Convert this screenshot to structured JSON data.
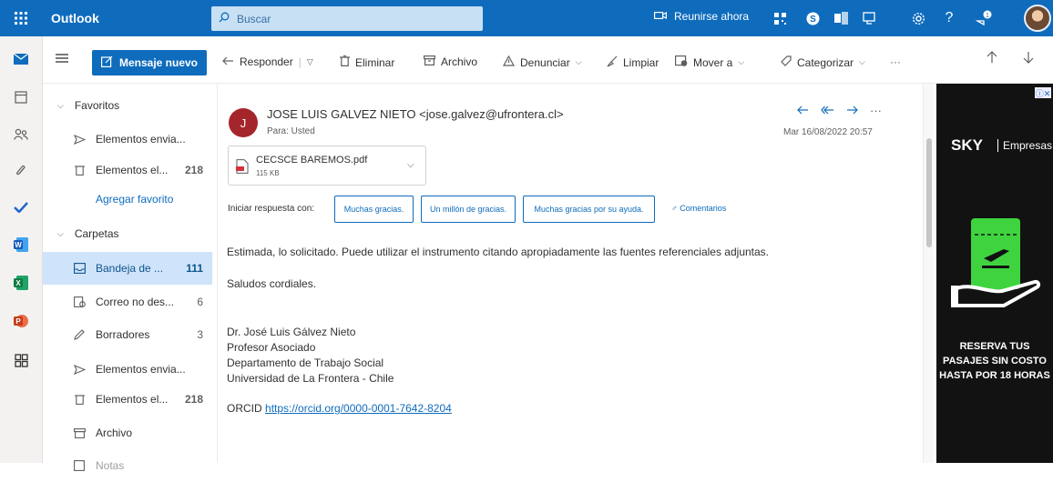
{
  "topbar": {
    "app_name": "Outlook",
    "search_placeholder": "Buscar",
    "meet_now": "Reunirse ahora",
    "notification_count": "1"
  },
  "commands": {
    "new_message": "Mensaje nuevo",
    "reply": "Responder",
    "delete": "Eliminar",
    "archive": "Archivo",
    "report": "Denunciar",
    "sweep": "Limpiar",
    "move_to": "Mover a",
    "categorize": "Categorizar",
    "more": "···"
  },
  "folders": {
    "favorites_header": "Favoritos",
    "favorites": [
      {
        "label": "Elementos envia...",
        "count": ""
      },
      {
        "label": "Elementos el...",
        "count": "218"
      }
    ],
    "add_favorite": "Agregar favorito",
    "folders_header": "Carpetas",
    "items": [
      {
        "label": "Bandeja de ...",
        "count": "111"
      },
      {
        "label": "Correo no des...",
        "count": "6"
      },
      {
        "label": "Borradores",
        "count": "3"
      },
      {
        "label": "Elementos envia...",
        "count": ""
      },
      {
        "label": "Elementos el...",
        "count": "218"
      },
      {
        "label": "Archivo",
        "count": ""
      },
      {
        "label": "Notas",
        "count": ""
      }
    ]
  },
  "message": {
    "sender_initial": "J",
    "from": "JOSE LUIS GALVEZ NIETO <jose.galvez@ufrontera.cl>",
    "to": "Para: Usted",
    "date": "Mar 16/08/2022 20:57",
    "attachment_name": "CECSCE BAREMOS.pdf",
    "attachment_size": "115 KB",
    "reply_label": "Iniciar respuesta con:",
    "quick_replies": [
      "Muchas gracias.",
      "Un millón de gracias.",
      "Muchas gracias por su ayuda."
    ],
    "feedback": "Comentarios",
    "body_line1": "Estimada, lo solicitado. Puede utilizar el instrumento citando apropiadamente las fuentes referenciales adjuntas.",
    "body_line2": "Saludos cordiales.",
    "sig_name": "Dr. José Luis Gálvez Nieto",
    "sig_title": "Profesor Asociado",
    "sig_dept": "Departamento de Trabajo Social",
    "sig_univ": "Universidad de La Frontera - Chile",
    "orcid_label": "ORCID",
    "orcid_link": "https://orcid.org/0000-0001-7642-8204"
  },
  "ad": {
    "brand": "SKY",
    "brand_sub": "Empresas",
    "promo": "RESERVA TUS PASAJES SIN COSTO HASTA POR 18 HORAS"
  },
  "colors": {
    "accent": "#0f6cbd",
    "selected": "#cfe4fa",
    "avatar": "#a4262c",
    "ad_bg": "#121212",
    "ad_green": "#3fd43f"
  }
}
